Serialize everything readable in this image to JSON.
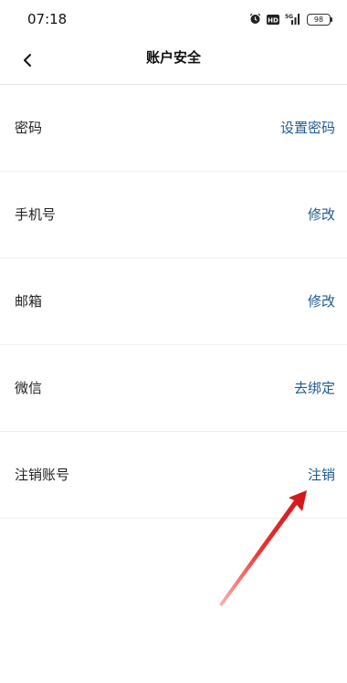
{
  "status_bar": {
    "time": "07:18",
    "signal_label": "5G",
    "hd_label": "HD",
    "battery": "98",
    "icons": [
      "alarm-icon",
      "hd-icon",
      "signal-icon",
      "battery-icon"
    ]
  },
  "nav": {
    "title": "账户安全",
    "back_icon": "chevron-left-icon"
  },
  "rows": [
    {
      "label": "密码",
      "action": "设置密码"
    },
    {
      "label": "手机号",
      "action": "修改"
    },
    {
      "label": "邮箱",
      "action": "修改"
    },
    {
      "label": "微信",
      "action": "去绑定"
    },
    {
      "label": "注销账号",
      "action": "注销"
    }
  ],
  "colors": {
    "action": "#1e5a8f",
    "annotation_arrow": "#e02020"
  }
}
